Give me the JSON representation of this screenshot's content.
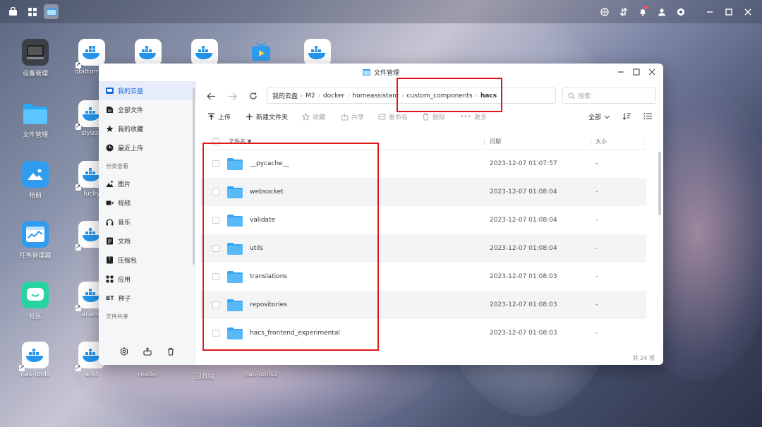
{
  "desktop": {
    "icons": [
      {
        "label": "设备管理",
        "icon": "device-manager-icon"
      },
      {
        "label": "qbittorrent",
        "icon": "docker-whale-icon"
      },
      {
        "label": "",
        "icon": "docker-whale-icon"
      },
      {
        "label": "",
        "icon": "docker-whale-icon"
      },
      {
        "label": "",
        "icon": "tv-icon"
      },
      {
        "label": "",
        "icon": "docker-whale-icon"
      },
      {
        "label": "文件管理",
        "icon": "folder-icon"
      },
      {
        "label": "siyuan",
        "icon": "docker-whale-icon"
      },
      {
        "label": "相册",
        "icon": "photo-icon"
      },
      {
        "label": "lucky",
        "icon": "docker-whale-icon"
      },
      {
        "label": "任务管理器",
        "icon": "task-manager-icon"
      },
      {
        "label": "",
        "icon": "docker-whale-icon"
      },
      {
        "label": "社区",
        "icon": "community-icon"
      },
      {
        "label": "ariang",
        "icon": "docker-whale-icon"
      },
      {
        "label": "nas-tools",
        "icon": "docker-whale-icon"
      },
      {
        "label": "alist",
        "icon": "docker-whale-icon"
      },
      {
        "label": "reader",
        "icon": "reader-icon"
      },
      {
        "label": "回收站",
        "icon": "trash-icon"
      },
      {
        "label": "nas-tools2",
        "icon": "docker-whale-icon"
      }
    ]
  },
  "window": {
    "title": "文件管理"
  },
  "sidebar": {
    "items": [
      {
        "label": "我的云盘",
        "icon": "cloud-icon"
      },
      {
        "label": "全部文件",
        "icon": "file-icon"
      },
      {
        "label": "我的收藏",
        "icon": "star-icon"
      },
      {
        "label": "最近上传",
        "icon": "clock-icon"
      }
    ],
    "section_category": "分类查看",
    "categories": [
      {
        "label": "图片",
        "icon": "image-icon"
      },
      {
        "label": "视频",
        "icon": "video-icon"
      },
      {
        "label": "音乐",
        "icon": "headphones-icon"
      },
      {
        "label": "文档",
        "icon": "document-icon"
      },
      {
        "label": "压缩包",
        "icon": "archive-icon"
      },
      {
        "label": "应用",
        "icon": "apps-icon"
      },
      {
        "label": "种子",
        "icon_text": "BT"
      }
    ],
    "section_share": "文件共享"
  },
  "nav": {
    "breadcrumb": [
      "我的云盘",
      "M2",
      "docker",
      "homeassistant",
      "custom_components",
      "hacs"
    ],
    "search_placeholder": "搜索"
  },
  "toolbar": {
    "upload": "上传",
    "new_folder": "新建文件夹",
    "favorite": "收藏",
    "share": "共享",
    "rename": "重命名",
    "delete": "删除",
    "more": "更多",
    "filter": "全部"
  },
  "table": {
    "headers": {
      "name": "文件名",
      "date": "日期",
      "size": "大小"
    },
    "rows": [
      {
        "name": "__pycache__",
        "date": "2023-12-07 01:07:57",
        "size": "-"
      },
      {
        "name": "websocket",
        "date": "2023-12-07 01:08:04",
        "size": "-"
      },
      {
        "name": "validate",
        "date": "2023-12-07 01:08:04",
        "size": "-"
      },
      {
        "name": "utils",
        "date": "2023-12-07 01:08:04",
        "size": "-"
      },
      {
        "name": "translations",
        "date": "2023-12-07 01:08:03",
        "size": "-"
      },
      {
        "name": "repositories",
        "date": "2023-12-07 01:08:03",
        "size": "-"
      },
      {
        "name": "hacs_frontend_experimental",
        "date": "2023-12-07 01:08:03",
        "size": "-"
      }
    ],
    "footer": "共 24 项"
  },
  "colors": {
    "accent": "#1769e0",
    "folder": "#4fb3f6",
    "highlight_box": "#e0161b"
  }
}
